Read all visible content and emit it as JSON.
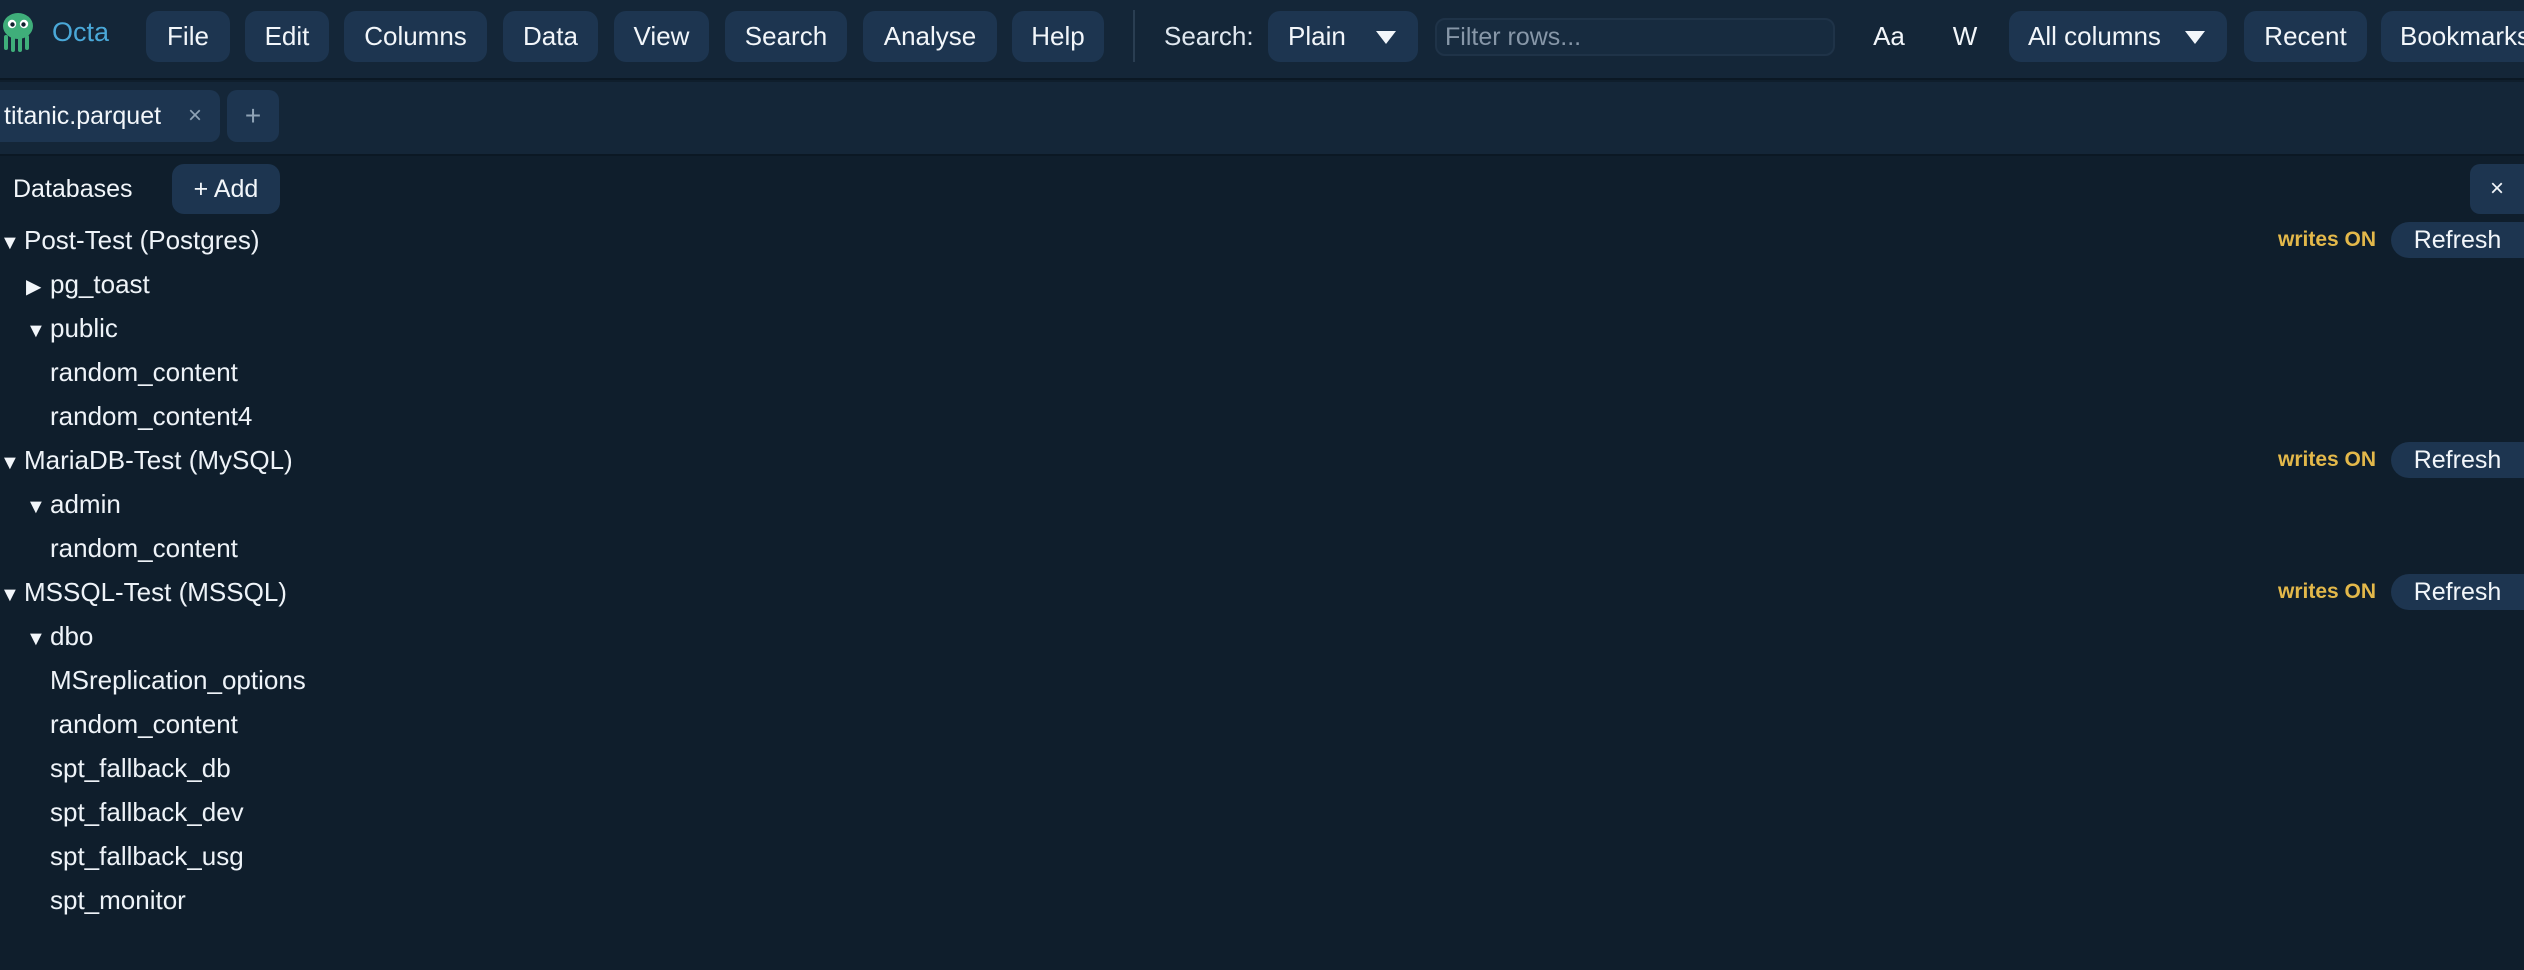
{
  "app": {
    "name": "Octa",
    "logo_icon": "octopus-logo-icon",
    "accent_color": "#4aa8d8",
    "background_color": "#0f1e2c"
  },
  "menu": {
    "items": [
      "File",
      "Edit",
      "Columns",
      "Data",
      "View",
      "Search",
      "Analyse",
      "Help"
    ]
  },
  "search": {
    "label": "Search:",
    "mode": "Plain",
    "placeholder": "Filter rows...",
    "value": "",
    "match_case": "Aa",
    "whole_word": "W",
    "scope": "All columns",
    "recent": "Recent",
    "bookmarks": "Bookmarks"
  },
  "tabs": {
    "items": [
      {
        "label": "titanic.parquet",
        "close": "×"
      }
    ],
    "new_tab": "+"
  },
  "databases": {
    "title": "Databases",
    "add_label": "+ Add",
    "close": "×",
    "writes_color": "#e3b84a",
    "connections": [
      {
        "label": "Post-Test (Postgres)",
        "writes": "writes ON",
        "refresh": "Refresh",
        "schemas": [
          {
            "label": "pg_toast",
            "expanded": false,
            "tables": []
          },
          {
            "label": "public",
            "expanded": true,
            "tables": [
              "random_content",
              "random_content4"
            ]
          }
        ]
      },
      {
        "label": "MariaDB-Test (MySQL)",
        "writes": "writes ON",
        "refresh": "Refresh",
        "schemas": [
          {
            "label": "admin",
            "expanded": true,
            "tables": [
              "random_content"
            ]
          }
        ]
      },
      {
        "label": "MSSQL-Test (MSSQL)",
        "writes": "writes ON",
        "refresh": "Refresh",
        "schemas": [
          {
            "label": "dbo",
            "expanded": true,
            "tables": [
              "MSreplication_options",
              "random_content",
              "spt_fallback_db",
              "spt_fallback_dev",
              "spt_fallback_usg",
              "spt_monitor"
            ]
          }
        ]
      }
    ]
  }
}
